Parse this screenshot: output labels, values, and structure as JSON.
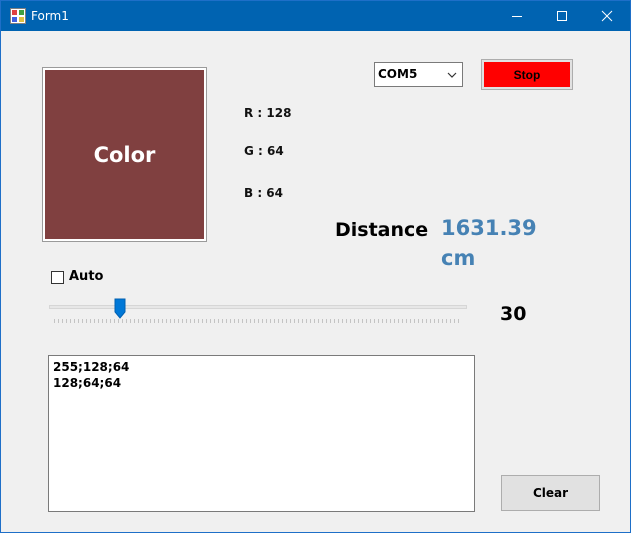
{
  "window": {
    "title": "Form1"
  },
  "color_panel": {
    "label": "Color",
    "color": "#804040"
  },
  "rgb": {
    "r": "R : 128",
    "g": "G : 64",
    "b": "B : 64"
  },
  "port": {
    "selected": "COM5"
  },
  "stop_button": {
    "label": "Stop",
    "color": "#ff0000"
  },
  "distance": {
    "label": "Distance",
    "value": "1631.39",
    "unit": "cm",
    "color": "#4682b4"
  },
  "auto": {
    "label": "Auto",
    "checked": false
  },
  "slider": {
    "value": "30",
    "position_fraction": 0.17
  },
  "log": {
    "lines": [
      "255;128;64",
      "128;64;64"
    ]
  },
  "clear_button": {
    "label": "Clear"
  },
  "icons": [
    "app-icon",
    "minimize-icon",
    "maximize-icon",
    "close-icon",
    "chevron-down-icon"
  ]
}
